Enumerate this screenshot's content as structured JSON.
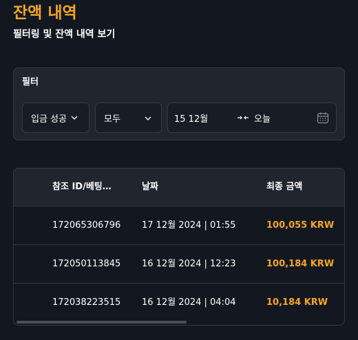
{
  "page": {
    "title": "잔액 내역",
    "subtitle": "필터링 및 잔액 내역 보기"
  },
  "filter": {
    "title": "필터",
    "status": {
      "value": "입금 성공",
      "icon": "chevron-down-icon"
    },
    "type": {
      "value": "모두",
      "icon": "chevron-down-icon"
    },
    "date_range": {
      "from": "15 12월",
      "to": "오늘",
      "separator_icon": "range-arrows-icon",
      "calendar_icon": "calendar-icon"
    }
  },
  "table": {
    "columns": [
      "참조 ID/베팅…",
      "날짜",
      "최종 금액"
    ],
    "rows": [
      {
        "ref": "172065306796",
        "date": "17 12월 2024 | 01:55",
        "amount": "100,055 KRW"
      },
      {
        "ref": "172050113845",
        "date": "16 12월 2024 | 12:23",
        "amount": "100,184 KRW"
      },
      {
        "ref": "172038223515",
        "date": "16 12월 2024 | 04:04",
        "amount": "10,184 KRW"
      }
    ]
  },
  "colors": {
    "accent": "#f5a623",
    "background": "#131820",
    "card": "#20252e",
    "border": "#343a45"
  }
}
